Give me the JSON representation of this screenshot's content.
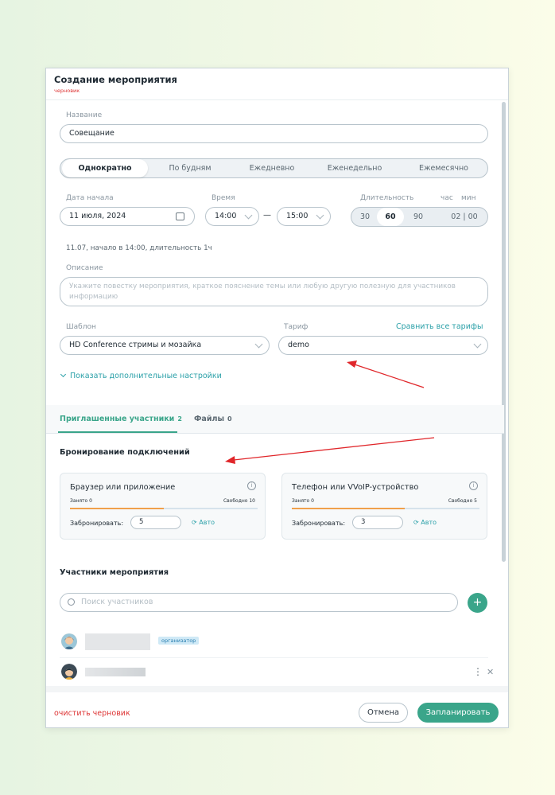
{
  "window": {
    "title": "Создание мероприятия",
    "subtitle": "черновик"
  },
  "name": {
    "label": "Название",
    "value": "Совещание"
  },
  "recurrence": {
    "options": [
      "Однократно",
      "По будням",
      "Ежедневно",
      "Еженедельно",
      "Ежемесячно"
    ],
    "selected": "Однократно"
  },
  "date": {
    "label": "Дата начала",
    "value": "11 июля, 2024"
  },
  "time": {
    "label": "Время",
    "start": "14:00",
    "end": "15:00",
    "separator": "—"
  },
  "duration": {
    "label": "Длительность",
    "unit_hours": "час",
    "unit_minutes": "мин",
    "options": [
      "30",
      "60",
      "90"
    ],
    "selected": "60",
    "value": "02 | 00"
  },
  "summary": "11.07, начало в 14:00, длительность 1ч",
  "description": {
    "label": "Описание",
    "placeholder": "Укажите повестку мероприятия, краткое пояснение темы или любую другую полезную для участников информацию"
  },
  "template": {
    "label": "Шаблон",
    "value": "HD Conference стримы и мозайка"
  },
  "tariff": {
    "label": "Тариф",
    "value": "demo",
    "compare_link": "Сравнить все тарифы"
  },
  "more_settings": "Показать дополнительные настройки",
  "tabs": [
    {
      "label": "Приглашенные участники",
      "count": "2"
    },
    {
      "label": "Файлы",
      "count": "0"
    }
  ],
  "booking": {
    "title": "Бронирование подключений",
    "cards": [
      {
        "title": "Браузер или приложение",
        "busy": "Занято 0",
        "free": "Свободно 10",
        "progress": 0.5,
        "reserve_label": "Забронировать:",
        "reserve_value": "5",
        "auto": "Авто"
      },
      {
        "title": "Телефон или VVoIP-устройство",
        "busy": "Занято 0",
        "free": "Свободно 5",
        "progress": 0.6,
        "reserve_label": "Забронировать:",
        "reserve_value": "3",
        "auto": "Авто"
      }
    ]
  },
  "participants": {
    "title": "Участники мероприятия",
    "search_placeholder": "Поиск участников",
    "organizer_badge": "организатор"
  },
  "footer": {
    "clear_draft": "очистить черновик",
    "cancel": "Отмена",
    "schedule": "Запланировать"
  },
  "colors": {
    "accent": "#3aa58a",
    "link": "#2aa0a8",
    "draft": "#d33",
    "arrow": "#e0262a"
  }
}
